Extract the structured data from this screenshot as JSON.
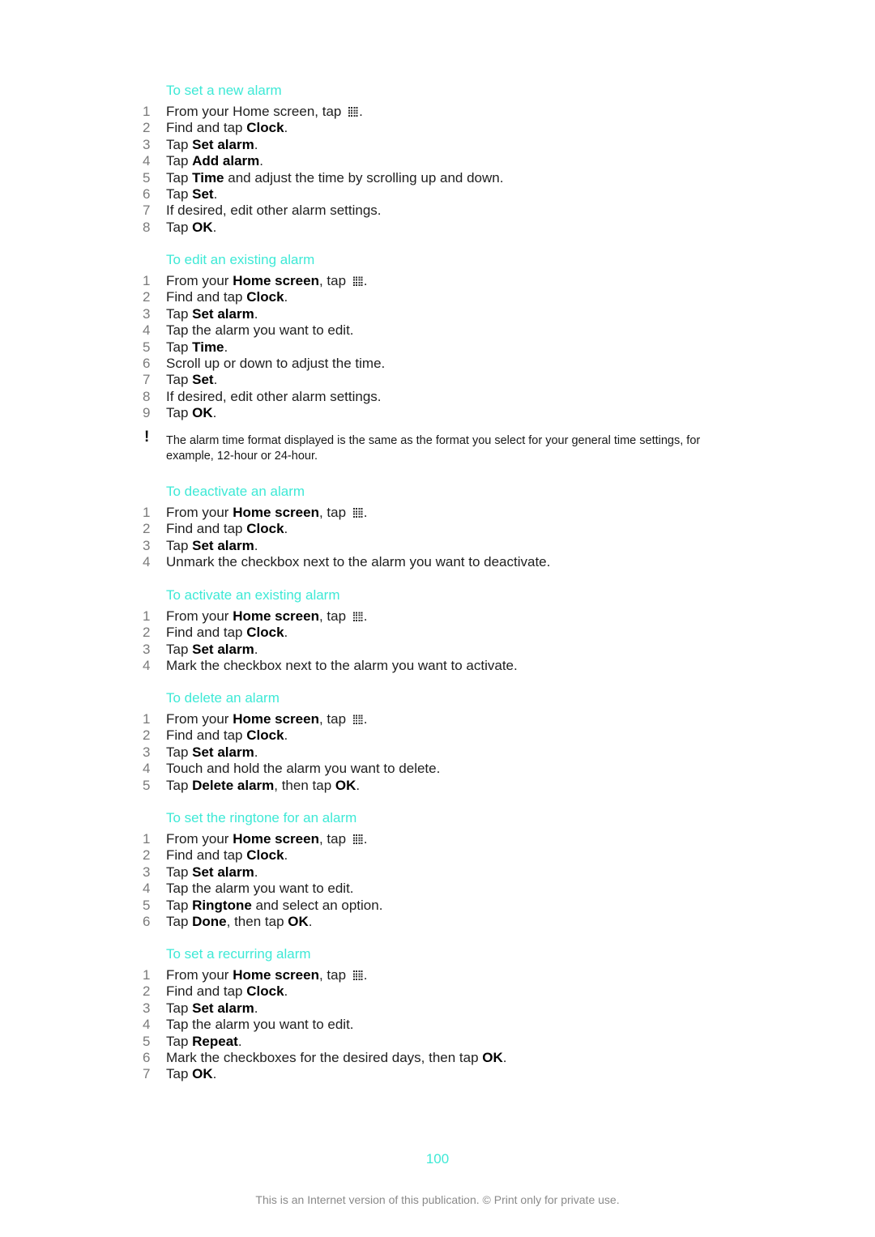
{
  "sections": [
    {
      "title": "To set a new alarm",
      "steps": [
        {
          "n": "1",
          "parts": [
            {
              "t": "From your Home screen, tap "
            },
            {
              "icon": "apps-grid-icon"
            },
            {
              "t": "."
            }
          ]
        },
        {
          "n": "2",
          "parts": [
            {
              "t": "Find and tap "
            },
            {
              "b": "Clock"
            },
            {
              "t": "."
            }
          ]
        },
        {
          "n": "3",
          "parts": [
            {
              "t": "Tap "
            },
            {
              "b": "Set alarm"
            },
            {
              "t": "."
            }
          ]
        },
        {
          "n": "4",
          "parts": [
            {
              "t": "Tap "
            },
            {
              "b": "Add alarm"
            },
            {
              "t": "."
            }
          ]
        },
        {
          "n": "5",
          "parts": [
            {
              "t": "Tap "
            },
            {
              "b": "Time"
            },
            {
              "t": " and adjust the time by scrolling up and down."
            }
          ]
        },
        {
          "n": "6",
          "parts": [
            {
              "t": "Tap "
            },
            {
              "b": "Set"
            },
            {
              "t": "."
            }
          ]
        },
        {
          "n": "7",
          "parts": [
            {
              "t": "If desired, edit other alarm settings."
            }
          ]
        },
        {
          "n": "8",
          "parts": [
            {
              "t": "Tap "
            },
            {
              "b": "OK"
            },
            {
              "t": "."
            }
          ]
        }
      ]
    },
    {
      "title": "To edit an existing alarm",
      "steps": [
        {
          "n": "1",
          "parts": [
            {
              "t": "From your "
            },
            {
              "b": "Home screen"
            },
            {
              "t": ", tap "
            },
            {
              "icon": "apps-grid-icon"
            },
            {
              "t": "."
            }
          ]
        },
        {
          "n": "2",
          "parts": [
            {
              "t": "Find and tap "
            },
            {
              "b": "Clock"
            },
            {
              "t": "."
            }
          ]
        },
        {
          "n": "3",
          "parts": [
            {
              "t": "Tap "
            },
            {
              "b": "Set alarm"
            },
            {
              "t": "."
            }
          ]
        },
        {
          "n": "4",
          "parts": [
            {
              "t": "Tap the alarm you want to edit."
            }
          ]
        },
        {
          "n": "5",
          "parts": [
            {
              "t": "Tap "
            },
            {
              "b": "Time"
            },
            {
              "t": "."
            }
          ]
        },
        {
          "n": "6",
          "parts": [
            {
              "t": "Scroll up or down to adjust the time."
            }
          ]
        },
        {
          "n": "7",
          "parts": [
            {
              "t": "Tap "
            },
            {
              "b": "Set"
            },
            {
              "t": "."
            }
          ]
        },
        {
          "n": "8",
          "parts": [
            {
              "t": "If desired, edit other alarm settings."
            }
          ]
        },
        {
          "n": "9",
          "parts": [
            {
              "t": "Tap "
            },
            {
              "b": "OK"
            },
            {
              "t": "."
            }
          ]
        }
      ]
    },
    {
      "title": "To deactivate an alarm",
      "steps": [
        {
          "n": "1",
          "parts": [
            {
              "t": "From your "
            },
            {
              "b": "Home screen"
            },
            {
              "t": ", tap "
            },
            {
              "icon": "apps-grid-icon"
            },
            {
              "t": "."
            }
          ]
        },
        {
          "n": "2",
          "parts": [
            {
              "t": "Find and tap "
            },
            {
              "b": "Clock"
            },
            {
              "t": "."
            }
          ]
        },
        {
          "n": "3",
          "parts": [
            {
              "t": "Tap "
            },
            {
              "b": "Set alarm"
            },
            {
              "t": "."
            }
          ]
        },
        {
          "n": "4",
          "parts": [
            {
              "t": "Unmark the checkbox next to the alarm you want to deactivate."
            }
          ]
        }
      ]
    },
    {
      "title": "To activate an existing alarm",
      "steps": [
        {
          "n": "1",
          "parts": [
            {
              "t": "From your "
            },
            {
              "b": "Home screen"
            },
            {
              "t": ", tap "
            },
            {
              "icon": "apps-grid-icon"
            },
            {
              "t": "."
            }
          ]
        },
        {
          "n": "2",
          "parts": [
            {
              "t": "Find and tap "
            },
            {
              "b": "Clock"
            },
            {
              "t": "."
            }
          ]
        },
        {
          "n": "3",
          "parts": [
            {
              "t": "Tap "
            },
            {
              "b": "Set alarm"
            },
            {
              "t": "."
            }
          ]
        },
        {
          "n": "4",
          "parts": [
            {
              "t": "Mark the checkbox next to the alarm you want to activate."
            }
          ]
        }
      ]
    },
    {
      "title": "To delete an alarm",
      "steps": [
        {
          "n": "1",
          "parts": [
            {
              "t": "From your "
            },
            {
              "b": "Home screen"
            },
            {
              "t": ", tap "
            },
            {
              "icon": "apps-grid-icon"
            },
            {
              "t": "."
            }
          ]
        },
        {
          "n": "2",
          "parts": [
            {
              "t": "Find and tap "
            },
            {
              "b": "Clock"
            },
            {
              "t": "."
            }
          ]
        },
        {
          "n": "3",
          "parts": [
            {
              "t": "Tap "
            },
            {
              "b": "Set alarm"
            },
            {
              "t": "."
            }
          ]
        },
        {
          "n": "4",
          "parts": [
            {
              "t": "Touch and hold the alarm you want to delete."
            }
          ]
        },
        {
          "n": "5",
          "parts": [
            {
              "t": "Tap "
            },
            {
              "b": "Delete alarm"
            },
            {
              "t": ", then tap "
            },
            {
              "b": "OK"
            },
            {
              "t": "."
            }
          ]
        }
      ]
    },
    {
      "title": "To set the ringtone for an alarm",
      "steps": [
        {
          "n": "1",
          "parts": [
            {
              "t": "From your "
            },
            {
              "b": "Home screen"
            },
            {
              "t": ", tap "
            },
            {
              "icon": "apps-grid-icon"
            },
            {
              "t": "."
            }
          ]
        },
        {
          "n": "2",
          "parts": [
            {
              "t": "Find and tap "
            },
            {
              "b": "Clock"
            },
            {
              "t": "."
            }
          ]
        },
        {
          "n": "3",
          "parts": [
            {
              "t": "Tap "
            },
            {
              "b": "Set alarm"
            },
            {
              "t": "."
            }
          ]
        },
        {
          "n": "4",
          "parts": [
            {
              "t": "Tap the alarm you want to edit."
            }
          ]
        },
        {
          "n": "5",
          "parts": [
            {
              "t": "Tap "
            },
            {
              "b": "Ringtone"
            },
            {
              "t": " and select an option."
            }
          ]
        },
        {
          "n": "6",
          "parts": [
            {
              "t": "Tap "
            },
            {
              "b": "Done"
            },
            {
              "t": ", then tap "
            },
            {
              "b": "OK"
            },
            {
              "t": "."
            }
          ]
        }
      ]
    },
    {
      "title": "To set a recurring alarm",
      "steps": [
        {
          "n": "1",
          "parts": [
            {
              "t": "From your "
            },
            {
              "b": "Home screen"
            },
            {
              "t": ", tap "
            },
            {
              "icon": "apps-grid-icon"
            },
            {
              "t": "."
            }
          ]
        },
        {
          "n": "2",
          "parts": [
            {
              "t": "Find and tap "
            },
            {
              "b": "Clock"
            },
            {
              "t": "."
            }
          ]
        },
        {
          "n": "3",
          "parts": [
            {
              "t": "Tap "
            },
            {
              "b": "Set alarm"
            },
            {
              "t": "."
            }
          ]
        },
        {
          "n": "4",
          "parts": [
            {
              "t": "Tap the alarm you want to edit."
            }
          ]
        },
        {
          "n": "5",
          "parts": [
            {
              "t": "Tap "
            },
            {
              "b": "Repeat"
            },
            {
              "t": "."
            }
          ]
        },
        {
          "n": "6",
          "parts": [
            {
              "t": "Mark the checkboxes for the desired days, then tap "
            },
            {
              "b": "OK"
            },
            {
              "t": "."
            }
          ]
        },
        {
          "n": "7",
          "parts": [
            {
              "t": "Tap "
            },
            {
              "b": "OK"
            },
            {
              "t": "."
            }
          ]
        }
      ]
    }
  ],
  "note": {
    "icon": "!",
    "text": "The alarm time format displayed is the same as the format you select for your general time settings, for example, 12-hour or 24-hour."
  },
  "page_number": "100",
  "footer": "This is an Internet version of this publication. © Print only for private use.",
  "colors": {
    "heading": "#3ee9d6",
    "step_number": "#7a7a7a",
    "footer": "#8a8a8a"
  }
}
